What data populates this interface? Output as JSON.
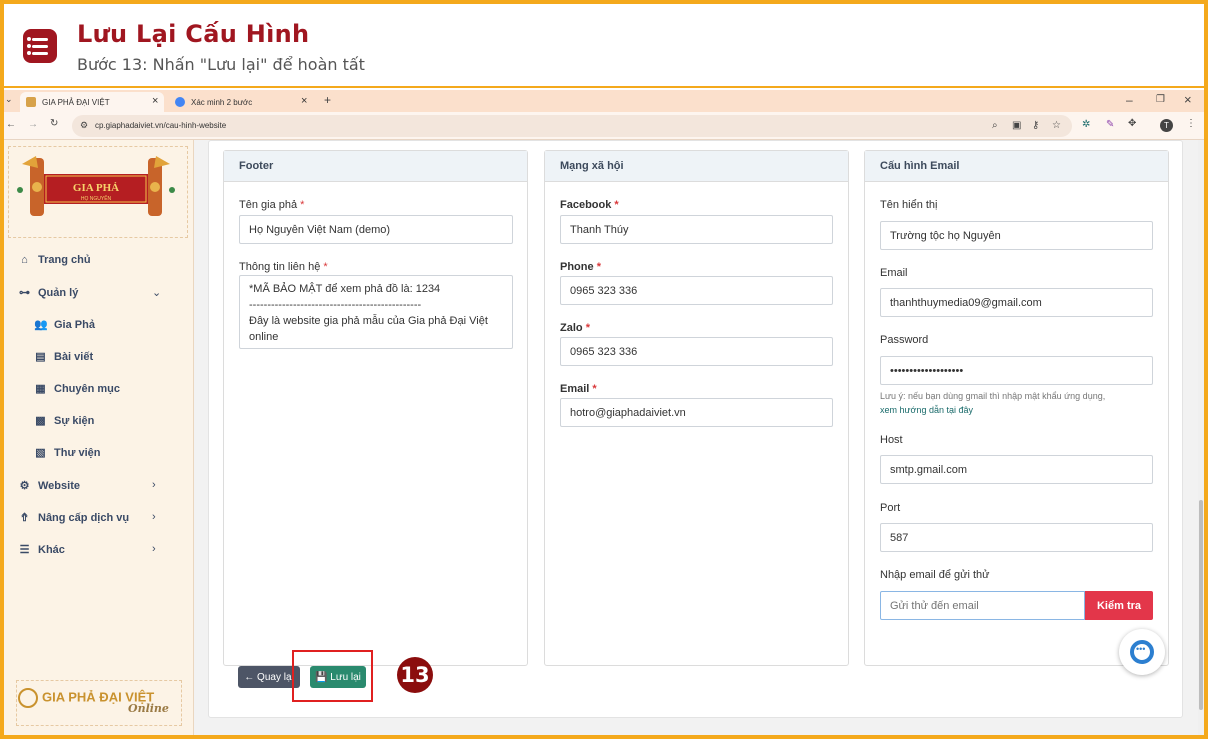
{
  "banner": {
    "title": "Lưu Lại Cấu Hình",
    "subtitle": "Bước 13: Nhấn \"Lưu lại\" để hoàn tất",
    "step_number": "13"
  },
  "browser": {
    "tabs": [
      {
        "label": "GIA PHẢ ĐẠI VIỆT"
      },
      {
        "label": "Xác minh 2 bước"
      }
    ],
    "new_tab": "+",
    "close": "×",
    "url": "cp.giaphadaiviet.vn/cau-hinh-website",
    "profile_initial": "T"
  },
  "sidebar": {
    "logo_text": "GIA PHẢ",
    "logo_sub": "HỌ NGUYỄN",
    "items": [
      {
        "label": "Trang chủ",
        "icon": "home-icon"
      },
      {
        "label": "Quản lý",
        "icon": "sitemap-icon"
      },
      {
        "label": "Gia Phả",
        "icon": "users-icon"
      },
      {
        "label": "Bài viết",
        "icon": "newspaper-icon"
      },
      {
        "label": "Chuyên mục",
        "icon": "table-icon"
      },
      {
        "label": "Sự kiện",
        "icon": "calendar-icon"
      },
      {
        "label": "Thư viện",
        "icon": "images-icon"
      },
      {
        "label": "Website",
        "icon": "gear-icon"
      },
      {
        "label": "Nâng cấp dịch vụ",
        "icon": "upgrade-icon"
      },
      {
        "label": "Khác",
        "icon": "bars-icon"
      }
    ],
    "footer_brand": "GIA PHẢ ĐẠI VIỆT",
    "footer_tag": "Online"
  },
  "footer_panel": {
    "title": "Footer",
    "name_label": "Tên gia phả",
    "name_value": "Họ Nguyễn Việt Nam (demo)",
    "contact_label": "Thông tin liên hệ",
    "contact_value": "*MÃ BẢO MẬT để xem phả đồ là: 1234\n-----------------------------------------------\nĐây là website gia phả mẫu của Gia phả Đại Việt online"
  },
  "social_panel": {
    "title": "Mạng xã hội",
    "facebook_label": "Facebook",
    "facebook_value": "Thanh Thúy",
    "phone_label": "Phone",
    "phone_value": "0965 323 336",
    "zalo_label": "Zalo",
    "zalo_value": "0965 323 336",
    "email_label": "Email",
    "email_value": "hotro@giaphadaiviet.vn"
  },
  "email_panel": {
    "title": "Cấu hình Email",
    "display_label": "Tên hiển thị",
    "display_value": "Trường tộc họ Nguyễn",
    "email_label": "Email",
    "email_value": "thanhthuymedia09@gmail.com",
    "password_label": "Password",
    "password_value": "•••••••••••••••••••",
    "note": "Lưu ý: nếu bạn dùng gmail thì nhập mật khẩu ứng dụng,",
    "note_link": "xem hướng dẫn tại đây",
    "host_label": "Host",
    "host_value": "smtp.gmail.com",
    "port_label": "Port",
    "port_value": "587",
    "test_label": "Nhập email để gửi thử",
    "test_placeholder": "Gửi thử đến email",
    "test_button": "Kiểm tra"
  },
  "actions": {
    "back_label": "← Quay lại",
    "save_label": "💾 Lưu lại"
  },
  "required_mark": "*",
  "colors": {
    "accent": "#a01620",
    "save": "#2a8a6e",
    "check": "#e3364a",
    "frame": "#f4a91c"
  }
}
